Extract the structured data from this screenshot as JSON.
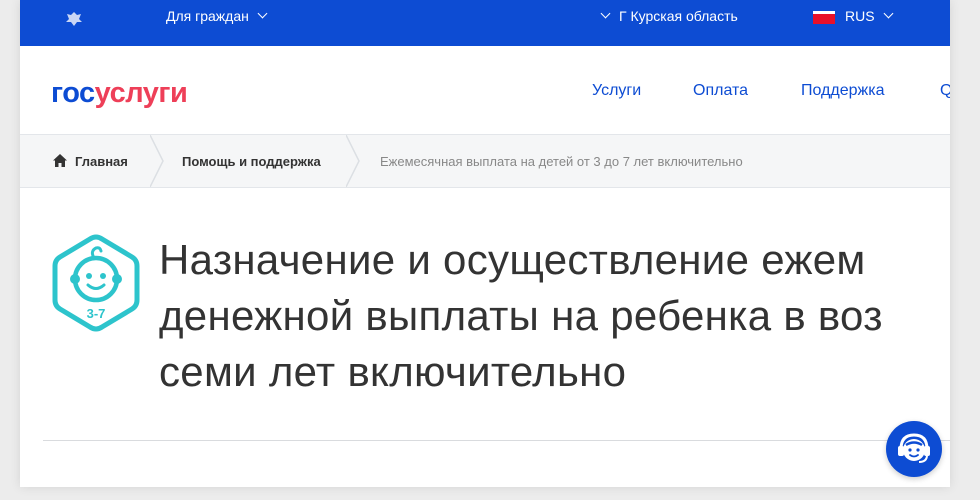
{
  "topbar": {
    "audience": "Для граждан",
    "region": "Г Курская область",
    "language": "RUS"
  },
  "header": {
    "logo": {
      "part1": "гос",
      "part2": "услуги"
    },
    "nav": [
      "Услуги",
      "Оплата",
      "Поддержка",
      "Q"
    ]
  },
  "breadcrumb": {
    "home": "Главная",
    "section": "Помощь и поддержка",
    "current": "Ежемесячная выплата на детей от 3 до 7 лет включительно"
  },
  "content": {
    "badge_label": "3-7",
    "title_lines": [
      "Назначение и осуществление ежем",
      "денежной выплаты на ребенка в воз",
      "семи лет включительно"
    ]
  },
  "colors": {
    "brand_blue": "#0d4cd3",
    "brand_red": "#ee3f58",
    "badge_teal": "#2dc4cc"
  },
  "icons": {
    "emblem": "emblem-icon",
    "home": "home-icon",
    "badge": "child-badge-icon",
    "support": "support-operator-icon"
  }
}
